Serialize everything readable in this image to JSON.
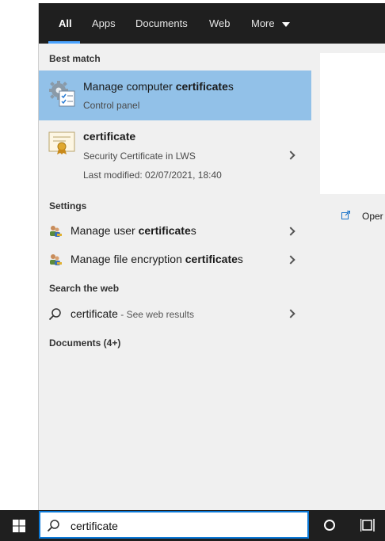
{
  "tabs": [
    {
      "label": "All",
      "active": true
    },
    {
      "label": "Apps",
      "active": false
    },
    {
      "label": "Documents",
      "active": false
    },
    {
      "label": "Web",
      "active": false
    },
    {
      "label": "More",
      "active": false
    }
  ],
  "sections": {
    "best_match": "Best match",
    "settings": "Settings",
    "search_web": "Search the web",
    "documents": "Documents (4+)"
  },
  "best_match": [
    {
      "title_prefix": "Manage computer ",
      "title_bold": "certificate",
      "title_suffix": "s",
      "subtitle": "Control panel",
      "icon": "settings-gear-icon",
      "selected": true
    },
    {
      "title_bold": "certificate",
      "subtitle": "Security Certificate in LWS",
      "modified": "Last modified: 02/07/2021, 18:40",
      "icon": "certificate-file-icon",
      "selected": false
    }
  ],
  "settings_items": [
    {
      "prefix": "Manage user ",
      "bold": "certificate",
      "suffix": "s",
      "icon": "users-key-icon"
    },
    {
      "prefix": "Manage file encryption ",
      "bold": "certificate",
      "suffix": "s",
      "icon": "users-key-icon"
    }
  ],
  "web_item": {
    "query": "certificate",
    "hint": " - See web results",
    "icon": "search-icon"
  },
  "preview": {
    "open_label": "Oper"
  },
  "search": {
    "value": "certificate"
  },
  "colors": {
    "selected": "#92c1e8",
    "accent": "#0a78d7",
    "tabbar": "#1f1f1f",
    "panel": "#f0f0f0"
  }
}
